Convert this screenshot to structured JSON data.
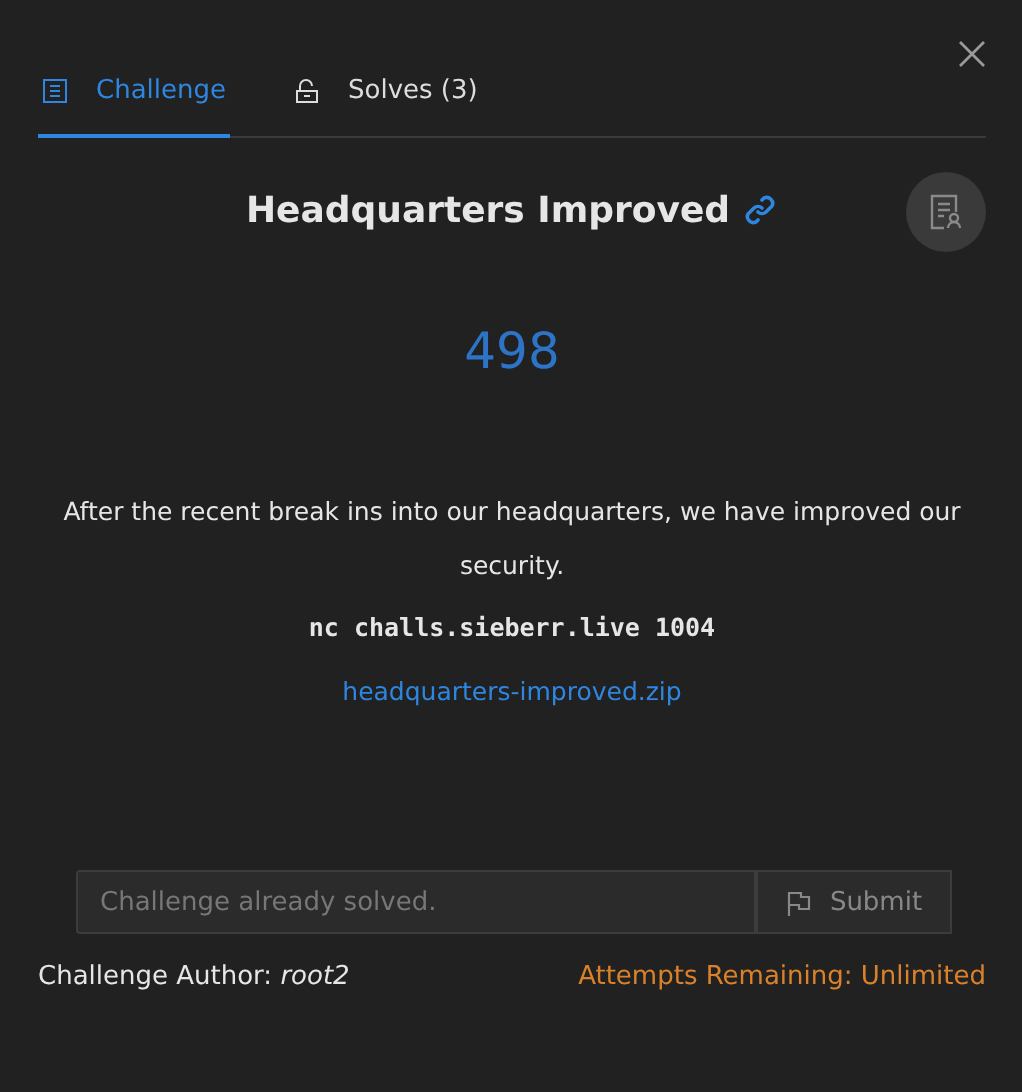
{
  "tabs": [
    {
      "label": "Challenge",
      "selected": true
    },
    {
      "label": "Solves (3)",
      "selected": false
    }
  ],
  "title": "Headquarters Improved",
  "points": "498",
  "description": "After the recent break ins into our headquarters, we have improved our security.",
  "command": "nc challs.sieberr.live 1004",
  "file": "headquarters-improved.zip",
  "flag_input": {
    "placeholder": "Challenge already solved.",
    "disabled": true
  },
  "submit": {
    "label": "Submit",
    "disabled": true
  },
  "author": {
    "label": "Challenge Author:",
    "name": "root2"
  },
  "attempts": "Attempts Remaining: Unlimited"
}
